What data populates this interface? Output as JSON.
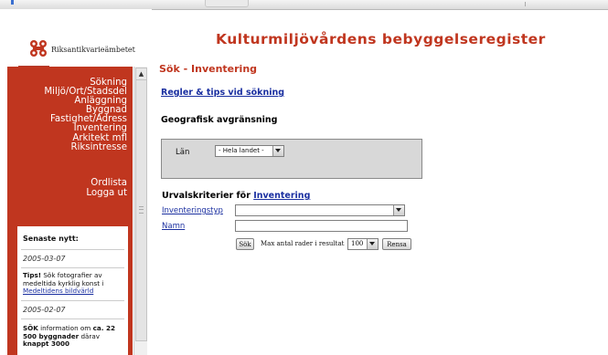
{
  "logo": {
    "text": "Riksantikvarieämbetet",
    "brand_color": "#c0361f"
  },
  "site_title": "Kulturmiljövårdens bebyggelseregister",
  "sidebar": {
    "nav_items": [
      {
        "label": "Sökning"
      },
      {
        "label": "Miljö/Ort/Stadsdel"
      },
      {
        "label": "Anläggning"
      },
      {
        "label": "Byggnad"
      },
      {
        "label": "Fastighet/Adress"
      },
      {
        "label": "Inventering"
      },
      {
        "label": "Arkitekt mfl"
      },
      {
        "label": "Riksintresse"
      }
    ],
    "secondary_items": [
      {
        "label": "Ordlista"
      },
      {
        "label": "Logga ut"
      }
    ],
    "news": {
      "title": "Senaste nytt:",
      "date1": "2005-03-07",
      "tip_bold": "Tips!",
      "tip_text": " Sök fotografier av medeltida kyrklig konst i ",
      "tip_link": "Medeltidens bildvärld",
      "date2": "2005-02-07",
      "info_bold1": "SÖK",
      "info_text1": " information om ",
      "info_bold2": "ca. 22 500 byggnader",
      "info_text2": " därav ",
      "info_bold3": "knappt 3000"
    }
  },
  "main": {
    "heading": "Sök - Inventering",
    "rules_link": "Regler & tips vid sökning",
    "geo_heading": "Geografisk avgränsning",
    "lan_label": "Län",
    "lan_value": "- Hela landet -",
    "criteria_heading_prefix": "Urvalskriterier för ",
    "criteria_heading_link": "Inventering",
    "field_inventeringstyp": "Inventeringstyp",
    "inventeringstyp_value": "",
    "field_namn": "Namn",
    "namn_value": "",
    "search_button": "Sök",
    "max_label": "Max antal rader i resultat",
    "max_value": "100",
    "reset_button": "Rensa"
  }
}
